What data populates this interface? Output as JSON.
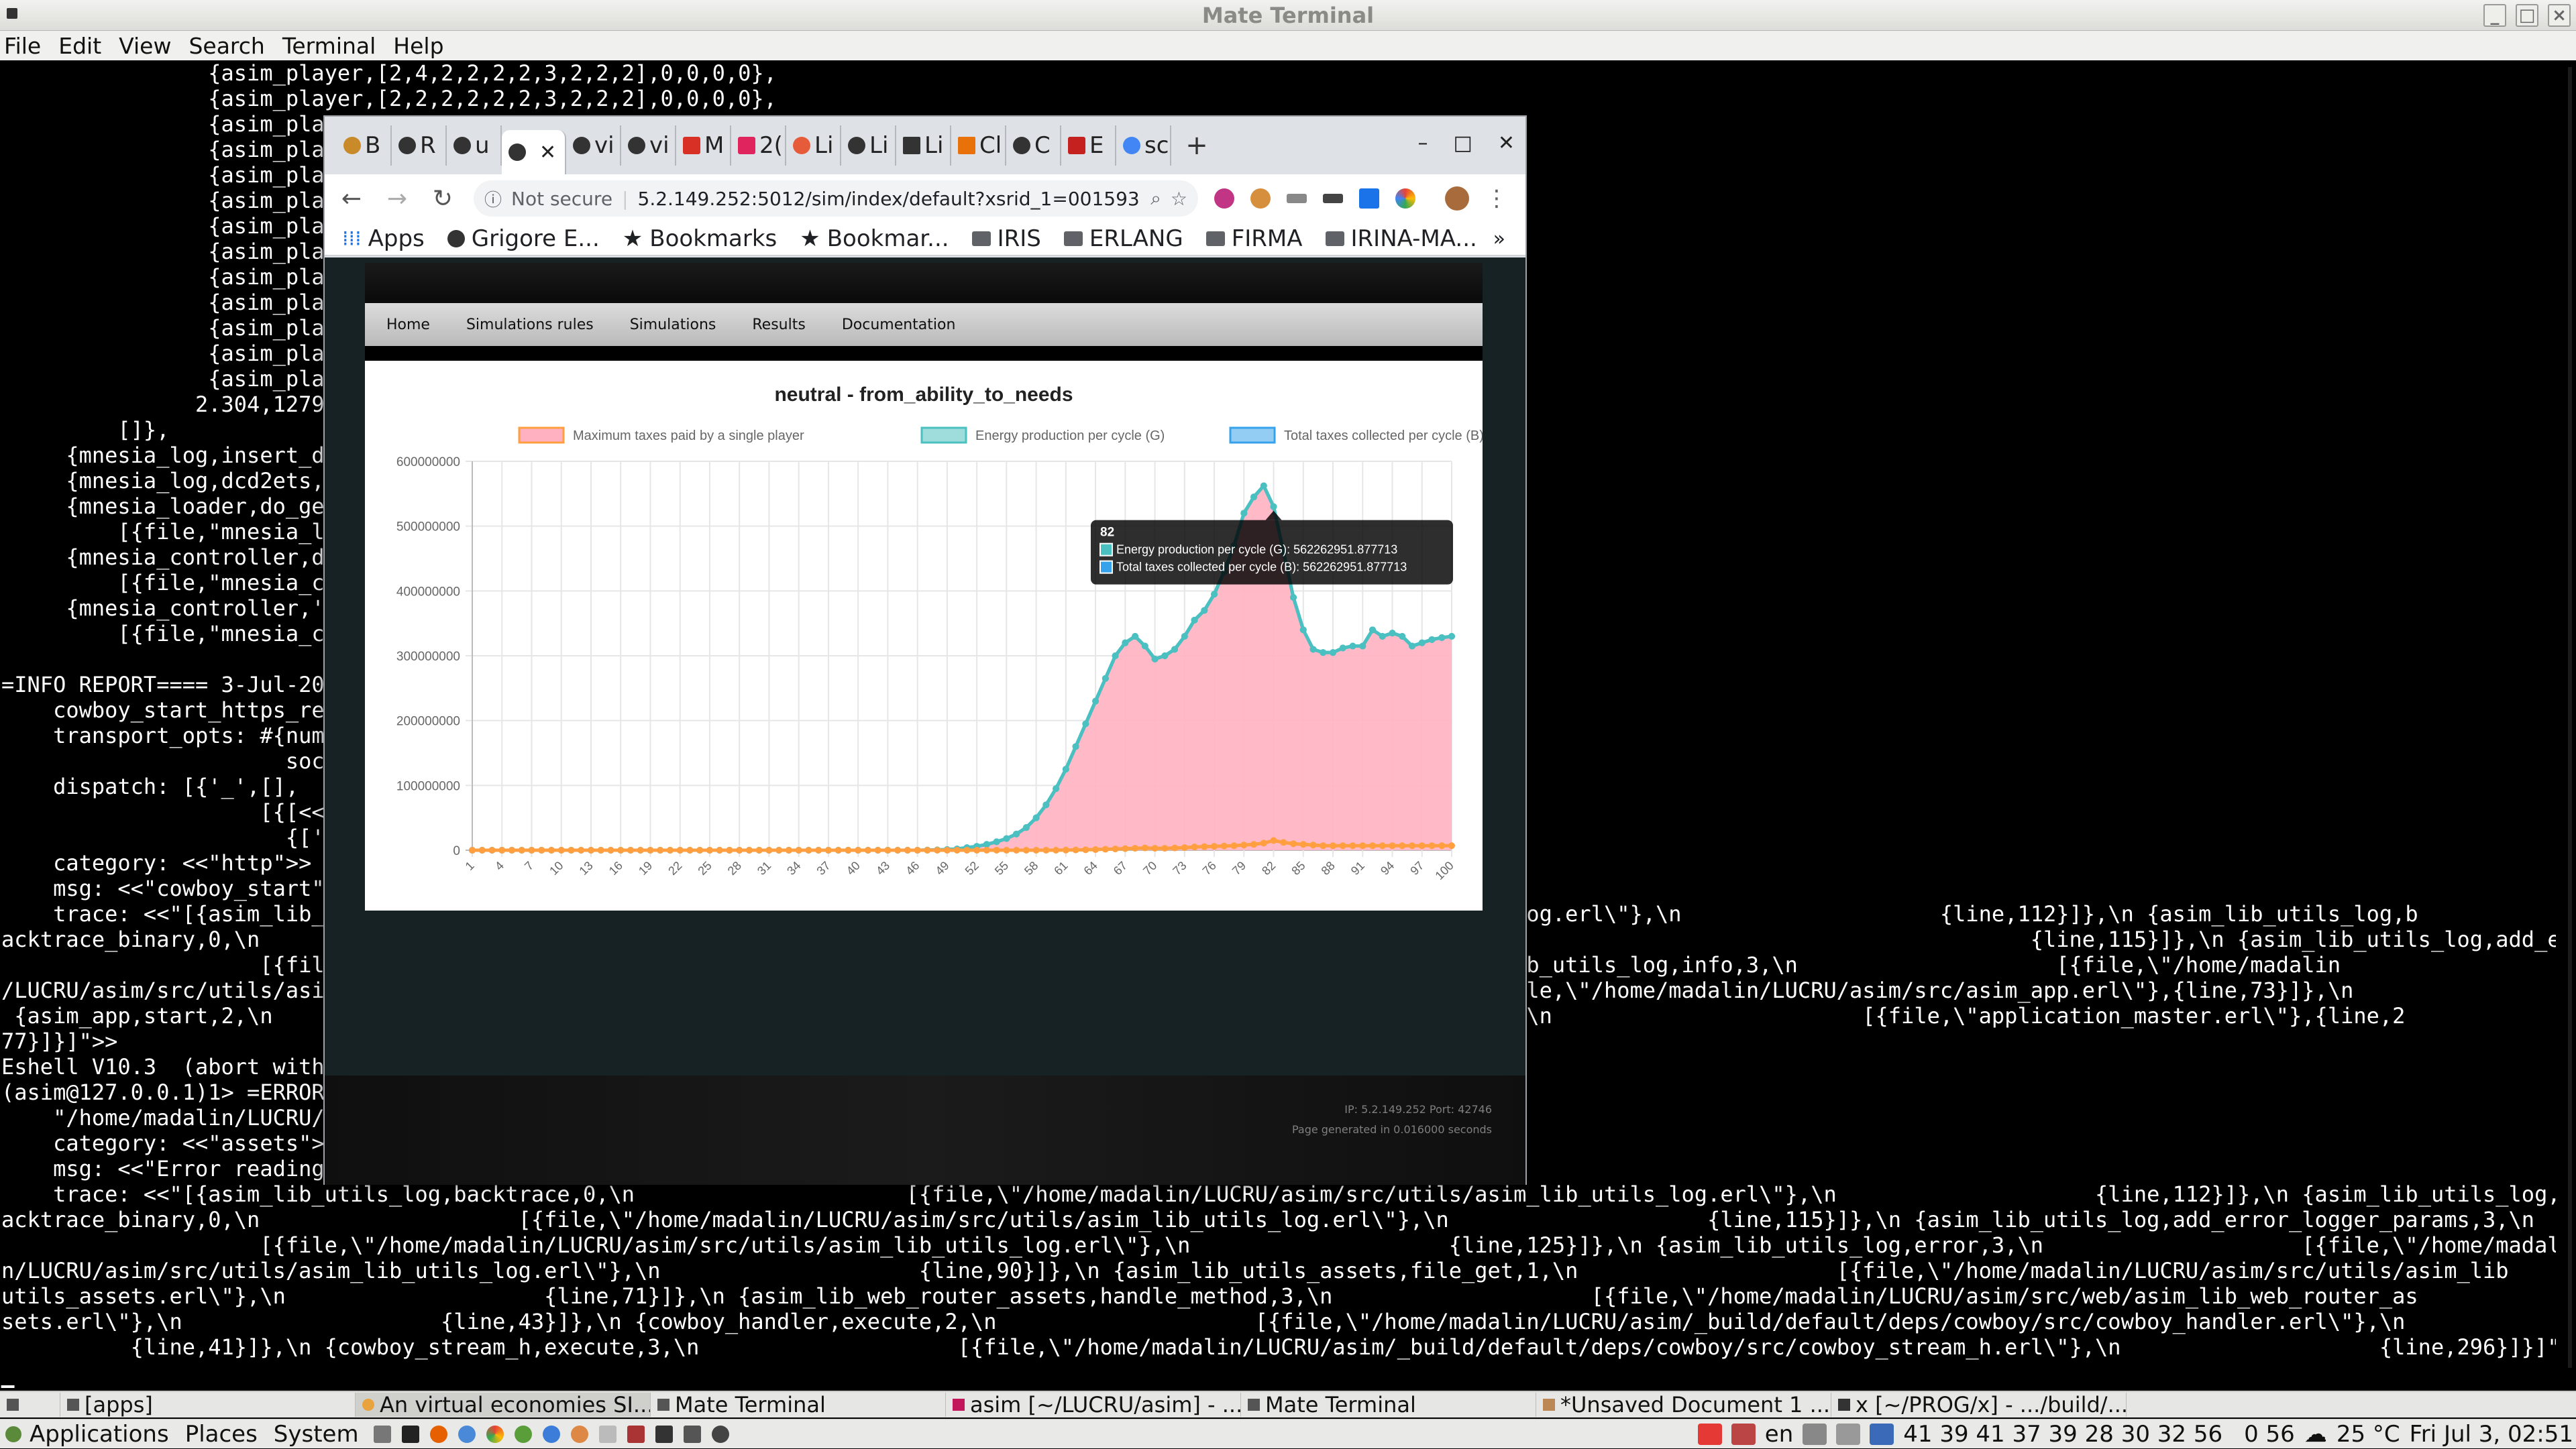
{
  "terminal": {
    "title": "Mate Terminal",
    "menu": [
      "File",
      "Edit",
      "View",
      "Search",
      "Terminal",
      "Help"
    ],
    "lines": [
      "                {asim_player,[2,4,2,2,2,2,3,2,2,2],0,0,0,0},",
      "                {asim_player,[2,2,2,2,2,2,3,2,2,2],0,0,0,0},",
      "                {asim_pla",
      "                {asim_pla",
      "                {asim_pla",
      "                {asim_pla",
      "                {asim_pla",
      "                {asim_pla",
      "                {asim_pla",
      "                {asim_pla",
      "                {asim_pla",
      "                {asim_pla",
      "                {asim_pla",
      "               2.304,1279",
      "         []},",
      "     {mnesia_log,insert_d",
      "     {mnesia_log,dcd2ets,",
      "     {mnesia_loader,do_ge",
      "         [{file,\"mnesia_l",
      "     {mnesia_controller,d",
      "         [{file,\"mnesia_c",
      "     {mnesia_controller,'",
      "         [{file,\"mnesia_c",
      "",
      "=INFO REPORT==== 3-Jul-20",
      "    cowboy_start_https_re",
      "    transport_opts: #{num",
      "                      soc",
      "    dispatch: [{'_',[],",
      "                    [{[<<",
      "                      {['.",
      "    category: <<\"http\">>",
      "    msg: <<\"cowboy_start\"",
      "    trace: <<\"[{asim_lib_                                                                                   ib_utils_log.erl\\\"},\\n                    {line,112}]},\\n {asim_lib_utils_log,b",
      "acktrace_binary,0,\\n                                                                                                                                         {line,115}]},\\n {asim_lib_utils_log,add_error_logger_params,3,\\n",
      "                    [{file                                                                           25}]},\\n {asim_lib_utils_log,info,3,\\n                    [{file,\\\"/home/madalin",
      "/LUCRU/asim/src/utils/asi                                                                           \\n            [{file,\\\"/home/madalin/LUCRU/asim/src/asim_app.erl\\\"},{line,73}]},\\n",
      " {asim_app,start,2,\\n                                                                                 ,start_it_old,4,\\n                        [{file,\\\"application_master.erl\\\"},{line,2",
      "77}]}]\">>",
      "Eshell V10.3  (abort with",
      "(asim@127.0.0.1)1> =ERROR",
      "    \"/home/madalin/LUCRU/",
      "    category: <<\"assets\">",
      "    msg: <<\"Error reading",
      "    trace: <<\"[{asim_lib_utils_log,backtrace,0,\\n                     [{file,\\\"/home/madalin/LUCRU/asim/src/utils/asim_lib_utils_log.erl\\\"},\\n                    {line,112}]},\\n {asim_lib_utils_log,b",
      "acktrace_binary,0,\\n                    [{file,\\\"/home/madalin/LUCRU/asim/src/utils/asim_lib_utils_log.erl\\\"},\\n                    {line,115}]},\\n {asim_lib_utils_log,add_error_logger_params,3,\\n",
      "                    [{file,\\\"/home/madalin/LUCRU/asim/src/utils/asim_lib_utils_log.erl\\\"},\\n                    {line,125}]},\\n {asim_lib_utils_log,error,3,\\n                    [{file,\\\"/home/madali",
      "n/LUCRU/asim/src/utils/asim_lib_utils_log.erl\\\"},\\n                    {line,90}]},\\n {asim_lib_utils_assets,file_get,1,\\n                    [{file,\\\"/home/madalin/LUCRU/asim/src/utils/asim_lib",
      "utils_assets.erl\\\"},\\n                    {line,71}]},\\n {asim_lib_web_router_assets,handle_method,3,\\n                    [{file,\\\"/home/madalin/LUCRU/asim/src/web/asim_lib_web_router_as",
      "sets.erl\\\"},\\n                    {line,43}]},\\n {cowboy_handler,execute,2,\\n                    [{file,\\\"/home/madalin/LUCRU/asim/_build/default/deps/cowboy/src/cowboy_handler.erl\\\"},\\n",
      "          {line,41}]},\\n {cowboy_stream_h,execute,3,\\n                    [{file,\\\"/home/madalin/LUCRU/asim/_build/default/deps/cowboy/src/cowboy_stream_h.erl\\\"},\\n                    {line,296}]}]\">>",
      "",
      "█"
    ]
  },
  "browser": {
    "tabs": [
      "B",
      "R",
      "u",
      "",
      "vi",
      "vi",
      "M",
      "2(",
      "Li",
      "Li",
      "Li",
      "Cl",
      "C",
      "E",
      "sc"
    ],
    "active_tab_index": 3,
    "window_buttons": [
      "–",
      "□",
      "✕"
    ],
    "not_secure": "Not secure",
    "url": "5.2.149.252:5012/sim/index/default?xsrid_1=00159373220997...",
    "bookmarks": [
      "Apps",
      "Grigore E...",
      "Bookmarks",
      "Bookmar...",
      "IRIS",
      "ERLANG",
      "FIRMA",
      "IRINA-MA..."
    ],
    "more": "»"
  },
  "site": {
    "nav": [
      "Home",
      "Simulations rules",
      "Simulations",
      "Results",
      "Documentation"
    ],
    "footer_ip": "IP: 5.2.149.252 Port: 42746",
    "footer_generated": "Page generated in 0.016000 seconds"
  },
  "chart_data": {
    "type": "line",
    "title": "neutral - from_ability_to_needs",
    "legend_placement": "top",
    "x_tick_labels": [
      "1",
      "4",
      "7",
      "10",
      "13",
      "16",
      "19",
      "22",
      "25",
      "28",
      "31",
      "34",
      "37",
      "40",
      "43",
      "46",
      "49",
      "52",
      "55",
      "58",
      "61",
      "64",
      "67",
      "70",
      "73",
      "76",
      "79",
      "82",
      "85",
      "88",
      "91",
      "94",
      "97",
      "100"
    ],
    "y_tick_labels": [
      "0",
      "100000000",
      "200000000",
      "300000000",
      "400000000",
      "500000000",
      "600000000"
    ],
    "ylim": [
      0,
      600000000
    ],
    "x_range": [
      1,
      100
    ],
    "grid": true,
    "series": [
      {
        "name": "Maximum taxes paid by a single player",
        "color": "#ff9f40",
        "fill": "#ffb1c1",
        "values": [
          0,
          0,
          0,
          0,
          0,
          0,
          0,
          0,
          0,
          0,
          0,
          0,
          0,
          0,
          0,
          0,
          0,
          0,
          0,
          0,
          0,
          0,
          0,
          0,
          0,
          0,
          0,
          0,
          0,
          0,
          0,
          0,
          0,
          0,
          0,
          0,
          0,
          0,
          0,
          0,
          0,
          0,
          0,
          0,
          0,
          0,
          0,
          0,
          0,
          0,
          0,
          0,
          0,
          0,
          0,
          0,
          0,
          0,
          0,
          0,
          200000,
          400000,
          700000,
          1000000,
          1500000,
          2000000,
          2500000,
          3000000,
          3500000,
          3000000,
          3000000,
          3500000,
          4000000,
          5000000,
          5500000,
          6000000,
          6500000,
          7000000,
          8000000,
          9000000,
          11000000,
          15000000,
          12000000,
          10000000,
          9000000,
          8000000,
          7000000,
          7000000,
          7000000,
          7000000,
          7000000,
          7000000,
          7000000,
          7000000,
          7000000,
          7000000,
          7000000,
          7000000,
          7000000,
          7000000
        ]
      },
      {
        "name": "Energy production per cycle (G)",
        "color": "#4bc0c0",
        "values": [
          0,
          0,
          0,
          0,
          0,
          0,
          0,
          0,
          0,
          0,
          0,
          0,
          0,
          0,
          0,
          0,
          0,
          0,
          0,
          0,
          0,
          0,
          0,
          0,
          0,
          0,
          0,
          0,
          0,
          0,
          0,
          0,
          0,
          0,
          0,
          0,
          0,
          0,
          0,
          0,
          0,
          0,
          0,
          0,
          0,
          0,
          200000,
          500000,
          1000000,
          2000000,
          4000000,
          6000000,
          9000000,
          13000000,
          18000000,
          25000000,
          35000000,
          50000000,
          70000000,
          95000000,
          125000000,
          160000000,
          195000000,
          230000000,
          265000000,
          300000000,
          320000000,
          330000000,
          315000000,
          295000000,
          300000000,
          310000000,
          330000000,
          355000000,
          370000000,
          395000000,
          430000000,
          470000000,
          520000000,
          545000000,
          562262951.877713,
          530000000,
          460000000,
          390000000,
          340000000,
          310000000,
          305000000,
          305000000,
          312000000,
          315000000,
          315000000,
          340000000,
          330000000,
          335000000,
          330000000,
          315000000,
          320000000,
          325000000,
          328000000,
          330000000
        ]
      },
      {
        "name": "Total taxes collected per cycle (B)",
        "color": "#36a2eb",
        "values": [
          0,
          0,
          0,
          0,
          0,
          0,
          0,
          0,
          0,
          0,
          0,
          0,
          0,
          0,
          0,
          0,
          0,
          0,
          0,
          0,
          0,
          0,
          0,
          0,
          0,
          0,
          0,
          0,
          0,
          0,
          0,
          0,
          0,
          0,
          0,
          0,
          0,
          0,
          0,
          0,
          0,
          0,
          0,
          0,
          0,
          0,
          200000,
          500000,
          1000000,
          2000000,
          4000000,
          6000000,
          9000000,
          13000000,
          18000000,
          25000000,
          35000000,
          50000000,
          70000000,
          95000000,
          125000000,
          160000000,
          195000000,
          230000000,
          265000000,
          300000000,
          320000000,
          330000000,
          315000000,
          295000000,
          300000000,
          310000000,
          330000000,
          355000000,
          370000000,
          395000000,
          430000000,
          470000000,
          520000000,
          545000000,
          562262951.877713,
          530000000,
          460000000,
          390000000,
          340000000,
          310000000,
          305000000,
          305000000,
          312000000,
          315000000,
          315000000,
          340000000,
          330000000,
          335000000,
          330000000,
          315000000,
          320000000,
          325000000,
          328000000,
          330000000
        ]
      }
    ],
    "tooltip": {
      "title": "82",
      "lines": [
        "Energy production per cycle (G): 562262951.877713",
        "Total taxes collected per cycle (B): 562262951.877713"
      ]
    }
  },
  "taskbar": {
    "items": [
      "[apps]",
      "An virtual economies SI...",
      "Mate Terminal",
      "asim [~/LUCRU/asim] - ...",
      "Mate Terminal",
      "*Unsaved Document 1 ...",
      "x [~/PROG/x] - .../build/..."
    ]
  },
  "panel": {
    "menus": [
      "Applications",
      "Places",
      "System"
    ],
    "lang": "en",
    "cpu": "41 39 41 37 39 28 30 32 56",
    "net": "0 56",
    "weather": "25 °C",
    "clock": "Fri Jul  3, 02:51"
  }
}
